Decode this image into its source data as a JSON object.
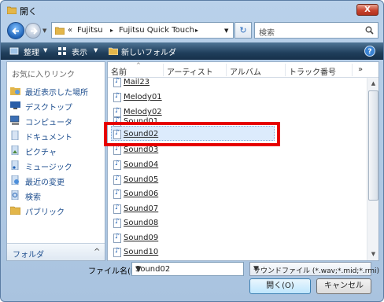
{
  "window": {
    "title": "開く",
    "close_label": "X"
  },
  "address": {
    "overflow": "«",
    "crumbs": [
      "Fujitsu",
      "Fujitsu Quick Touch"
    ],
    "sep": "▸",
    "search_placeholder": "検索"
  },
  "toolbar": {
    "organize": "整理",
    "views": "表示",
    "new_folder": "新しいフォルダ",
    "help": "?"
  },
  "nav": {
    "favorites_header": "お気に入りリンク",
    "items": [
      {
        "label": "最近表示した場所",
        "icon": "recent-places-icon"
      },
      {
        "label": "デスクトップ",
        "icon": "desktop-icon"
      },
      {
        "label": "コンピュータ",
        "icon": "computer-icon"
      },
      {
        "label": "ドキュメント",
        "icon": "documents-icon"
      },
      {
        "label": "ピクチャ",
        "icon": "pictures-icon"
      },
      {
        "label": "ミュージック",
        "icon": "music-icon"
      },
      {
        "label": "最近の変更",
        "icon": "recently-changed-icon"
      },
      {
        "label": "検索",
        "icon": "searches-icon"
      },
      {
        "label": "パブリック",
        "icon": "public-icon"
      }
    ],
    "folders_label": "フォルダ",
    "folders_chevron": "^"
  },
  "files": {
    "columns": [
      "名前",
      "アーティスト",
      "アルバム",
      "トラック番号"
    ],
    "more": "»",
    "items": [
      "Mail23",
      "Melody01",
      "Melody02",
      "Sound01",
      "Sound02",
      "Sound03",
      "Sound04",
      "Sound05",
      "Sound06",
      "Sound07",
      "Sound08",
      "Sound09",
      "Sound10"
    ],
    "selected": "Sound02"
  },
  "bottom": {
    "filename_label": "ファイル名(N):",
    "filename_value": "Sound02",
    "filetype_value": "サウンドファイル (*.wav;*.mid;*.rmi)",
    "open_label": "開く(O)",
    "cancel_label": "キャンセル"
  },
  "colors": {
    "highlight_frame": "#e60000",
    "toolbar": "#203f5c"
  }
}
